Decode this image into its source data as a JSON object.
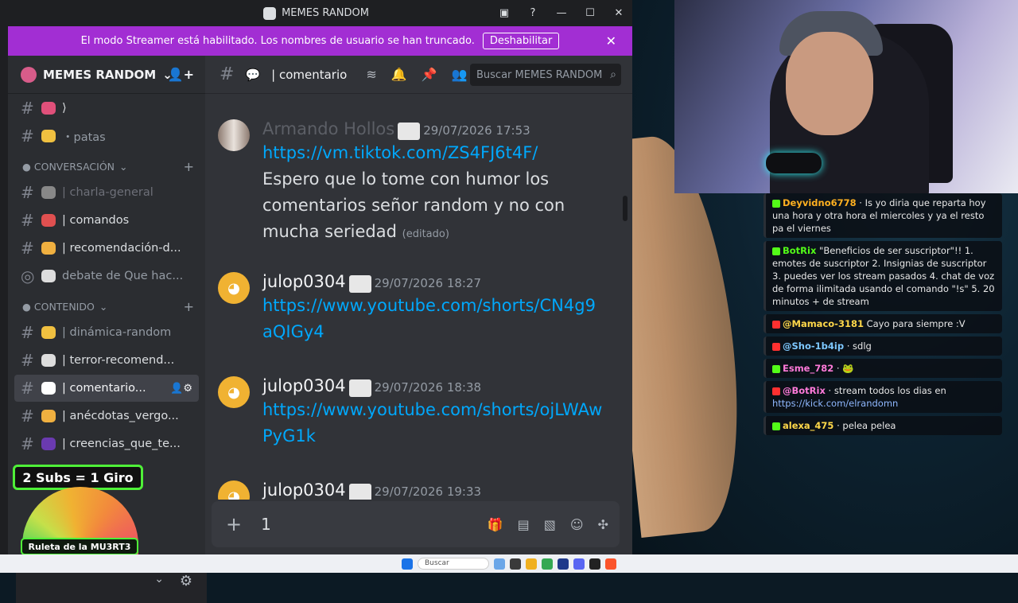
{
  "window": {
    "title": "MEMES RANDOM"
  },
  "banner": {
    "text": "El modo Streamer está habilitado. Los nombres de usuario se han truncado.",
    "button": "Deshabilitar"
  },
  "server": {
    "name": "MEMES RANDOM"
  },
  "sidebar": {
    "top_channels": [
      {
        "name": "⟩",
        "style": "bright"
      },
      {
        "name": "・patas",
        "style": "normal"
      }
    ],
    "categories": [
      {
        "label": "● CONVERSACIÓN",
        "channels": [
          {
            "name": "| charla-general",
            "style": "dim"
          },
          {
            "name": "| comandos",
            "style": "bright"
          },
          {
            "name": "| recomendación-d...",
            "style": "bright"
          },
          {
            "name": "debate de Que hac...",
            "style": "normal"
          }
        ]
      },
      {
        "label": "● CONTENIDO",
        "channels": [
          {
            "name": "| dinámica-random",
            "style": "normal"
          },
          {
            "name": "| terror-recomend...",
            "style": "bright"
          },
          {
            "name": "| comentario...",
            "style": "active"
          },
          {
            "name": "| anécdotas_vergo...",
            "style": "bright"
          },
          {
            "name": "| creencias_que_te...",
            "style": "bright"
          }
        ]
      }
    ]
  },
  "channel_header": {
    "name": "| comentario",
    "search_placeholder": "Buscar MEMES RANDOM"
  },
  "messages": [
    {
      "user": "Armando Hollos",
      "time": "29/07/2026 17:53",
      "link": "https://vm.tiktok.com/ZS4FJ6t4F/",
      "text": "Espero que lo tome con humor los comentarios señor random y no con mucha seriedad",
      "edited": "(editado)"
    },
    {
      "user": "julop0304",
      "time": "29/07/2026 18:27",
      "link": "https://www.youtube.com/shorts/CN4g9aQIGy4"
    },
    {
      "user": "julop0304",
      "time": "29/07/2026 18:38",
      "link": "https://www.youtube.com/shorts/ojLWAwPyG1k"
    },
    {
      "user": "julop0304",
      "time": "29/07/2026 19:33"
    }
  ],
  "composer": {
    "value": "1"
  },
  "overlay": {
    "subs": "2 Subs = 1 Giro",
    "wheel_label": "Ruleta de la MU3RT3"
  },
  "kick_chat": [
    {
      "user": "Deyvidno6778",
      "text": "Is yo diria que reparta hoy una hora y otra hora el miercoles y ya el resto pa el viernes",
      "color": "#ffb020"
    },
    {
      "user": "BotRix",
      "text": "\"Beneficios de ser suscriptor\"!! 1. emotes de suscriptor 2. Insignias de suscriptor 3. puedes ver los stream pasados 4. chat de voz de forma ilimitada usando el comando \"!s\" 5. 20 minutos + de stream",
      "color": "#53fc18"
    },
    {
      "user": "@Mamaco-3181",
      "text": "Cayo para siempre :V",
      "color": "#ffd84a"
    },
    {
      "user": "@Sho-1b4ip",
      "text": "sdlg",
      "color": "#7ec8ff"
    },
    {
      "user": "Esme_782",
      "text": "🐸",
      "color": "#ff7ad9"
    },
    {
      "user": "@BotRix",
      "text": "stream todos los dias en",
      "link": "https://kick.com/elrandomn",
      "color": "#ff7ad9"
    },
    {
      "user": "alexa_475",
      "text": "pelea pelea",
      "color": "#ffd84a"
    }
  ],
  "taskbar": {
    "search": "Buscar"
  },
  "colors": {
    "banner": "#a22ed3",
    "link": "#00a8fc",
    "kick": "#53fc18"
  }
}
